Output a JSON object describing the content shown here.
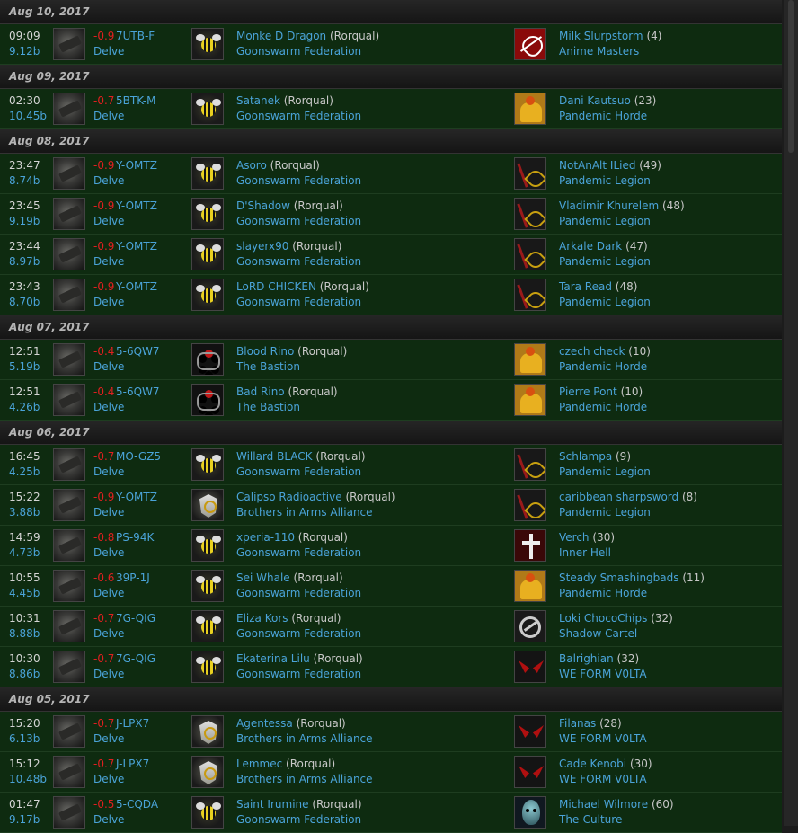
{
  "days": [
    {
      "date": "Aug 10, 2017",
      "kills": [
        {
          "time": "09:09",
          "isk": "9.12b",
          "sec": "-0.9",
          "system": "7UTB-F",
          "region": "Delve",
          "victim": "Monke D Dragon",
          "ship": "(Rorqual)",
          "victim_alliance": "Goonswarm Federation",
          "victim_logo": "goonswarm",
          "killer": "Milk Slurpstorm",
          "count": "(4)",
          "killer_alliance": "Anime Masters",
          "killer_logo": "anime"
        }
      ]
    },
    {
      "date": "Aug 09, 2017",
      "kills": [
        {
          "time": "02:30",
          "isk": "10.45b",
          "sec": "-0.7",
          "system": "5BTK-M",
          "region": "Delve",
          "victim": "Satanek",
          "ship": "(Rorqual)",
          "victim_alliance": "Goonswarm Federation",
          "victim_logo": "goonswarm",
          "killer": "Dani Kautsuo",
          "count": "(23)",
          "killer_alliance": "Pandemic Horde",
          "killer_logo": "horde"
        }
      ]
    },
    {
      "date": "Aug 08, 2017",
      "kills": [
        {
          "time": "23:47",
          "isk": "8.74b",
          "sec": "-0.9",
          "system": "Y-OMTZ",
          "region": "Delve",
          "victim": "Asoro",
          "ship": "(Rorqual)",
          "victim_alliance": "Goonswarm Federation",
          "victim_logo": "goonswarm",
          "killer": "NotAnAlt ILied",
          "count": "(49)",
          "killer_alliance": "Pandemic Legion",
          "killer_logo": "legion"
        },
        {
          "time": "23:45",
          "isk": "9.19b",
          "sec": "-0.9",
          "system": "Y-OMTZ",
          "region": "Delve",
          "victim": "D'Shadow",
          "ship": "(Rorqual)",
          "victim_alliance": "Goonswarm Federation",
          "victim_logo": "goonswarm",
          "killer": "Vladimir Khurelem",
          "count": "(48)",
          "killer_alliance": "Pandemic Legion",
          "killer_logo": "legion"
        },
        {
          "time": "23:44",
          "isk": "8.97b",
          "sec": "-0.9",
          "system": "Y-OMTZ",
          "region": "Delve",
          "victim": "slayerx90",
          "ship": "(Rorqual)",
          "victim_alliance": "Goonswarm Federation",
          "victim_logo": "goonswarm",
          "killer": "Arkale Dark",
          "count": "(47)",
          "killer_alliance": "Pandemic Legion",
          "killer_logo": "legion"
        },
        {
          "time": "23:43",
          "isk": "8.70b",
          "sec": "-0.9",
          "system": "Y-OMTZ",
          "region": "Delve",
          "victim": "LoRD CHICKEN",
          "ship": "(Rorqual)",
          "victim_alliance": "Goonswarm Federation",
          "victim_logo": "goonswarm",
          "killer": "Tara Read",
          "count": "(48)",
          "killer_alliance": "Pandemic Legion",
          "killer_logo": "legion"
        }
      ]
    },
    {
      "date": "Aug 07, 2017",
      "kills": [
        {
          "time": "12:51",
          "isk": "5.19b",
          "sec": "-0.4",
          "system": "5-6QW7",
          "region": "Delve",
          "victim": "Blood Rino",
          "ship": "(Rorqual)",
          "victim_alliance": "The Bastion",
          "victim_logo": "bastion",
          "killer": "czech check",
          "count": "(10)",
          "killer_alliance": "Pandemic Horde",
          "killer_logo": "horde"
        },
        {
          "time": "12:51",
          "isk": "4.26b",
          "sec": "-0.4",
          "system": "5-6QW7",
          "region": "Delve",
          "victim": "Bad Rino",
          "ship": "(Rorqual)",
          "victim_alliance": "The Bastion",
          "victim_logo": "bastion",
          "killer": "Pierre Pont",
          "count": "(10)",
          "killer_alliance": "Pandemic Horde",
          "killer_logo": "horde"
        }
      ]
    },
    {
      "date": "Aug 06, 2017",
      "kills": [
        {
          "time": "16:45",
          "isk": "4.25b",
          "sec": "-0.7",
          "system": "MO-GZ5",
          "region": "Delve",
          "victim": "Willard BLACK",
          "ship": "(Rorqual)",
          "victim_alliance": "Goonswarm Federation",
          "victim_logo": "goonswarm",
          "killer": "Schlampa",
          "count": "(9)",
          "killer_alliance": "Pandemic Legion",
          "killer_logo": "legion"
        },
        {
          "time": "15:22",
          "isk": "3.88b",
          "sec": "-0.9",
          "system": "Y-OMTZ",
          "region": "Delve",
          "victim": "Calipso Radioactive",
          "ship": "(Rorqual)",
          "victim_alliance": "Brothers in Arms Alliance",
          "victim_logo": "brothers",
          "killer": "caribbean sharpsword",
          "count": "(8)",
          "killer_alliance": "Pandemic Legion",
          "killer_logo": "legion"
        },
        {
          "time": "14:59",
          "isk": "4.73b",
          "sec": "-0.8",
          "system": "PS-94K",
          "region": "Delve",
          "victim": "xperia-110",
          "ship": "(Rorqual)",
          "victim_alliance": "Goonswarm Federation",
          "victim_logo": "goonswarm",
          "killer": "Verch",
          "count": "(30)",
          "killer_alliance": "Inner Hell",
          "killer_logo": "innerhell"
        },
        {
          "time": "10:55",
          "isk": "4.45b",
          "sec": "-0.6",
          "system": "39P-1J",
          "region": "Delve",
          "victim": "Sei Whale",
          "ship": "(Rorqual)",
          "victim_alliance": "Goonswarm Federation",
          "victim_logo": "goonswarm",
          "killer": "Steady Smashingbads",
          "count": "(11)",
          "killer_alliance": "Pandemic Horde",
          "killer_logo": "horde"
        },
        {
          "time": "10:31",
          "isk": "8.88b",
          "sec": "-0.7",
          "system": "7G-QIG",
          "region": "Delve",
          "victim": "Eliza Kors",
          "ship": "(Rorqual)",
          "victim_alliance": "Goonswarm Federation",
          "victim_logo": "goonswarm",
          "killer": "Loki ChocoChips",
          "count": "(32)",
          "killer_alliance": "Shadow Cartel",
          "killer_logo": "shadow"
        },
        {
          "time": "10:30",
          "isk": "8.86b",
          "sec": "-0.7",
          "system": "7G-QIG",
          "region": "Delve",
          "victim": "Ekaterina Lilu",
          "ship": "(Rorqual)",
          "victim_alliance": "Goonswarm Federation",
          "victim_logo": "goonswarm",
          "killer": "Balrighian",
          "count": "(32)",
          "killer_alliance": "WE FORM V0LTA",
          "killer_logo": "volta"
        }
      ]
    },
    {
      "date": "Aug 05, 2017",
      "kills": [
        {
          "time": "15:20",
          "isk": "6.13b",
          "sec": "-0.7",
          "system": "J-LPX7",
          "region": "Delve",
          "victim": "Agentessa",
          "ship": "(Rorqual)",
          "victim_alliance": "Brothers in Arms Alliance",
          "victim_logo": "brothers",
          "killer": "Filanas",
          "count": "(28)",
          "killer_alliance": "WE FORM V0LTA",
          "killer_logo": "volta"
        },
        {
          "time": "15:12",
          "isk": "10.48b",
          "sec": "-0.7",
          "system": "J-LPX7",
          "region": "Delve",
          "victim": "Lemmec",
          "ship": "(Rorqual)",
          "victim_alliance": "Brothers in Arms Alliance",
          "victim_logo": "brothers",
          "killer": "Cade Kenobi",
          "count": "(30)",
          "killer_alliance": "WE FORM V0LTA",
          "killer_logo": "volta"
        },
        {
          "time": "01:47",
          "isk": "9.17b",
          "sec": "-0.5",
          "system": "5-CQDA",
          "region": "Delve",
          "victim": "Saint Irumine",
          "ship": "(Rorqual)",
          "victim_alliance": "Goonswarm Federation",
          "victim_logo": "goonswarm",
          "killer": "Michael Wilmore",
          "count": "(60)",
          "killer_alliance": "The-Culture",
          "killer_logo": "culture"
        }
      ]
    }
  ]
}
